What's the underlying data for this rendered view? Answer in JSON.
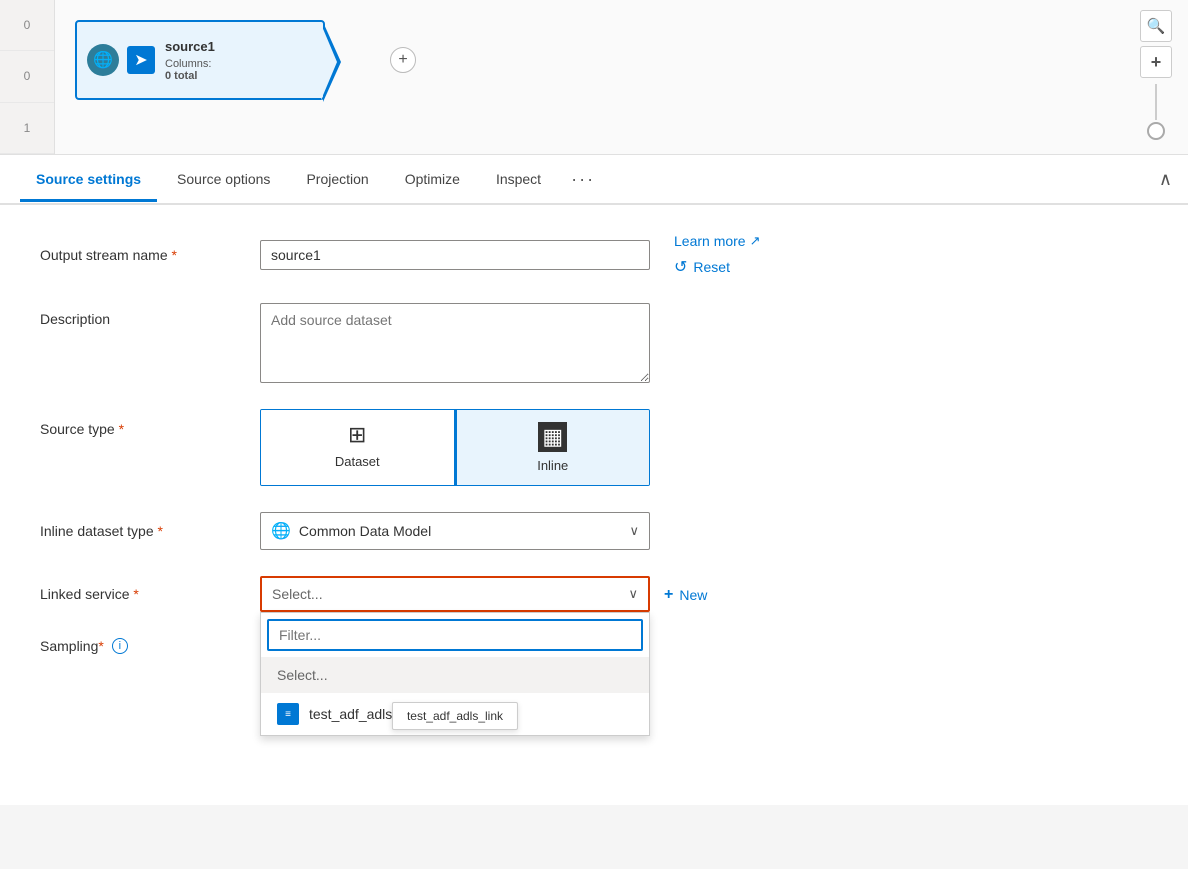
{
  "topbar": {
    "node_name": "source1",
    "node_columns_label": "Columns:",
    "node_columns_value": "0 total",
    "plus_btn": "+",
    "left_numbers": [
      "0",
      "0",
      "1"
    ],
    "left_numbers_main": [
      "0"
    ]
  },
  "tabs": {
    "items": [
      {
        "label": "Source settings",
        "active": true
      },
      {
        "label": "Source options",
        "active": false
      },
      {
        "label": "Projection",
        "active": false
      },
      {
        "label": "Optimize",
        "active": false
      },
      {
        "label": "Inspect",
        "active": false
      }
    ],
    "more_label": "···"
  },
  "form": {
    "output_stream_label": "Output stream name",
    "output_stream_value": "source1",
    "description_label": "Description",
    "description_placeholder": "Add source dataset",
    "source_type_label": "Source type",
    "dataset_option": "Dataset",
    "inline_option": "Inline",
    "inline_dataset_type_label": "Inline dataset type",
    "inline_dataset_value": "Common Data Model",
    "linked_service_label": "Linked service",
    "linked_service_placeholder": "Select...",
    "sampling_label": "Sampling",
    "learn_more_label": "Learn more",
    "reset_label": "Reset",
    "new_label": "New",
    "filter_placeholder": "Filter...",
    "dropdown_items": [
      {
        "label": "Select...",
        "type": "placeholder"
      },
      {
        "label": "test_adf_adls_link",
        "type": "item"
      }
    ],
    "tooltip_text": "test_adf_adls_link"
  },
  "icons": {
    "search": "🔍",
    "plus": "+",
    "chevron_down": "∨",
    "chevron_up": "∧",
    "external_link": "↗",
    "reset": "↺",
    "cdm": "🌐",
    "adls": "≡",
    "info": "i",
    "dataset_grid": "⊞",
    "inline_striped": "▦"
  }
}
